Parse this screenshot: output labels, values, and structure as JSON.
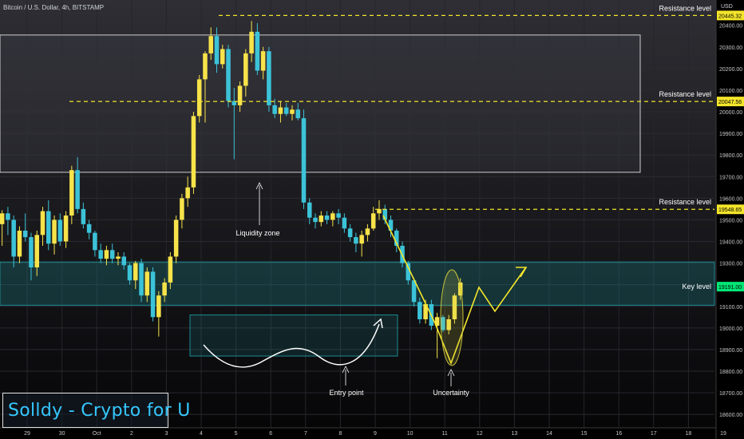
{
  "header": {
    "title": "Bitcoin / U.S. Dollar, 4h, BITSTAMP",
    "currency": "USD"
  },
  "watermark": {
    "text": "Solldy - Crypto for U"
  },
  "colors": {
    "background": "#000000",
    "bull_candle": "#f7e34a",
    "bear_candle": "#3cc3d8",
    "resistance_line": "#f4e52b",
    "zone_teal": "#1b8b93",
    "zone_gray": "#4a4a56",
    "price_label_yellow": "#f4e52b",
    "price_label_green": "#00e676",
    "axis_text": "#c8c8c8"
  },
  "chart_data": {
    "type": "candlestick",
    "title": "Bitcoin / U.S. Dollar, 4h, BITSTAMP",
    "y_axis": {
      "unit": "USD",
      "ylim": [
        18560,
        20480
      ],
      "ticks": [
        20400,
        20300,
        20200,
        20100,
        20000,
        19900,
        19800,
        19700,
        19600,
        19500,
        19400,
        19300,
        19200,
        19100,
        19000,
        18900,
        18800,
        18700,
        18600
      ],
      "tick_labels": [
        "20400.00",
        "20300.00",
        "20200.00",
        "20100.00",
        "20000.00",
        "19900.00",
        "19800.00",
        "19700.00",
        "19600.00",
        "19500.00",
        "19400.00",
        "19300.00",
        "19200.00",
        "19100.00",
        "19000.00",
        "18900.00",
        "18800.00",
        "18700.00",
        "18600.00"
      ]
    },
    "x_axis": {
      "tick_labels": [
        "29",
        "30",
        "Oct",
        "2",
        "3",
        "4",
        "5",
        "6",
        "7",
        "8",
        "9",
        "10",
        "11",
        "12",
        "13",
        "14",
        "15",
        "16",
        "17",
        "18",
        "19"
      ],
      "bars_per_label": 6
    },
    "candles": [
      [
        19480,
        19545,
        19380,
        19530
      ],
      [
        19530,
        19560,
        19430,
        19500
      ],
      [
        19500,
        19520,
        19280,
        19330
      ],
      [
        19330,
        19470,
        19300,
        19450
      ],
      [
        19450,
        19530,
        19400,
        19420
      ],
      [
        19420,
        19440,
        19220,
        19280
      ],
      [
        19280,
        19450,
        19240,
        19430
      ],
      [
        19430,
        19560,
        19380,
        19540
      ],
      [
        19540,
        19590,
        19360,
        19390
      ],
      [
        19390,
        19520,
        19340,
        19500
      ],
      [
        19500,
        19530,
        19380,
        19400
      ],
      [
        19400,
        19540,
        19370,
        19520
      ],
      [
        19520,
        19750,
        19480,
        19730
      ],
      [
        19730,
        19790,
        19530,
        19550
      ],
      [
        19550,
        19580,
        19460,
        19480
      ],
      [
        19480,
        19500,
        19410,
        19440
      ],
      [
        19440,
        19450,
        19330,
        19360
      ],
      [
        19360,
        19390,
        19300,
        19320
      ],
      [
        19320,
        19380,
        19290,
        19360
      ],
      [
        19360,
        19390,
        19300,
        19320
      ],
      [
        19320,
        19350,
        19290,
        19330
      ],
      [
        19330,
        19350,
        19270,
        19290
      ],
      [
        19290,
        19300,
        19200,
        19220
      ],
      [
        19220,
        19310,
        19180,
        19300
      ],
      [
        19300,
        19320,
        19120,
        19150
      ],
      [
        19150,
        19280,
        19120,
        19260
      ],
      [
        19260,
        19280,
        19030,
        19050
      ],
      [
        19050,
        19170,
        18960,
        19150
      ],
      [
        19150,
        19230,
        19120,
        19210
      ],
      [
        19210,
        19350,
        19180,
        19330
      ],
      [
        19330,
        19520,
        19300,
        19500
      ],
      [
        19500,
        19620,
        19460,
        19600
      ],
      [
        19600,
        19700,
        19560,
        19650
      ],
      [
        19650,
        20000,
        19620,
        19980
      ],
      [
        19980,
        20170,
        19950,
        20150
      ],
      [
        20150,
        20280,
        19950,
        20270
      ],
      [
        20270,
        20390,
        20240,
        20350
      ],
      [
        20350,
        20390,
        20180,
        20220
      ],
      [
        20220,
        20310,
        20200,
        20290
      ],
      [
        20290,
        20310,
        20020,
        20050
      ],
      [
        20050,
        20110,
        19780,
        20030
      ],
      [
        20030,
        20140,
        20000,
        20120
      ],
      [
        20120,
        20290,
        20070,
        20270
      ],
      [
        20270,
        20420,
        20230,
        20370
      ],
      [
        20370,
        20410,
        20170,
        20190
      ],
      [
        20190,
        20300,
        20150,
        20280
      ],
      [
        20280,
        20300,
        20000,
        20030
      ],
      [
        20030,
        20060,
        19970,
        19990
      ],
      [
        19990,
        20050,
        19950,
        20020
      ],
      [
        20020,
        20040,
        19980,
        19990
      ],
      [
        19990,
        20030,
        19960,
        20010
      ],
      [
        20010,
        20040,
        19960,
        19970
      ],
      [
        19970,
        20010,
        19550,
        19580
      ],
      [
        19580,
        19600,
        19480,
        19510
      ],
      [
        19510,
        19530,
        19460,
        19490
      ],
      [
        19490,
        19540,
        19470,
        19520
      ],
      [
        19520,
        19540,
        19480,
        19500
      ],
      [
        19500,
        19540,
        19470,
        19530
      ],
      [
        19530,
        19550,
        19480,
        19510
      ],
      [
        19510,
        19530,
        19440,
        19460
      ],
      [
        19460,
        19480,
        19400,
        19420
      ],
      [
        19420,
        19440,
        19350,
        19390
      ],
      [
        19390,
        19450,
        19330,
        19430
      ],
      [
        19430,
        19480,
        19400,
        19460
      ],
      [
        19460,
        19560,
        19450,
        19530
      ],
      [
        19530,
        19590,
        19500,
        19550
      ],
      [
        19550,
        19570,
        19480,
        19500
      ],
      [
        19500,
        19520,
        19420,
        19450
      ],
      [
        19450,
        19460,
        19350,
        19380
      ],
      [
        19380,
        19400,
        19280,
        19300
      ],
      [
        19300,
        19310,
        19200,
        19220
      ],
      [
        19220,
        19230,
        19100,
        19120
      ],
      [
        19120,
        19140,
        19020,
        19040
      ],
      [
        19040,
        19130,
        19020,
        19110
      ],
      [
        19110,
        19130,
        18990,
        19010
      ],
      [
        19010,
        19070,
        18860,
        19050
      ],
      [
        19050,
        19060,
        18980,
        18990
      ],
      [
        18990,
        19060,
        18970,
        19040
      ],
      [
        19040,
        19160,
        19020,
        19150
      ],
      [
        19150,
        19230,
        19130,
        19210
      ]
    ],
    "annotations": [
      {
        "type": "resistance",
        "label": "Resistance level",
        "price": 20445.32,
        "price_label": "20445.32"
      },
      {
        "type": "resistance",
        "label": "Resistance level",
        "price": 20047.56,
        "price_label": "20047.56"
      },
      {
        "type": "resistance",
        "label": "Resistance level",
        "price": 19548.65,
        "price_label": "19548.65"
      },
      {
        "type": "key_level",
        "label": "Key level",
        "price": 19191.0,
        "price_label": "19191.00",
        "zone": [
          19105,
          19305
        ]
      },
      {
        "type": "zone",
        "label": "Liquidity zone",
        "range": [
          19720,
          20355
        ]
      },
      {
        "type": "zone",
        "label": "Entry point",
        "range": [
          18870,
          19060
        ]
      },
      {
        "type": "note",
        "label": "Uncertainty"
      }
    ]
  }
}
